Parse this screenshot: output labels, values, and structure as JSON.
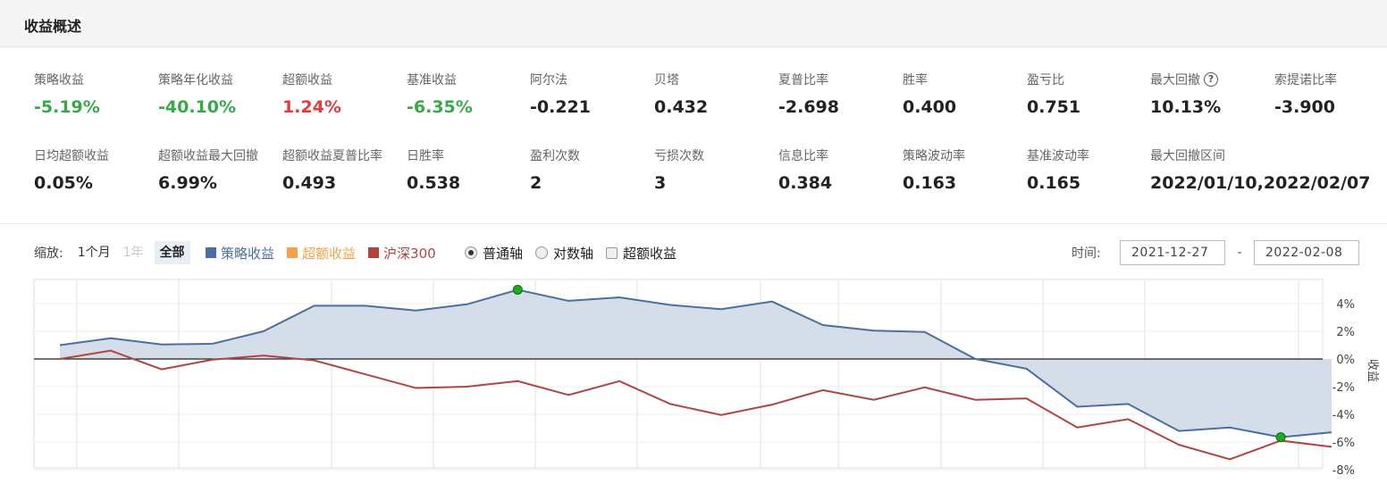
{
  "header": {
    "title": "收益概述"
  },
  "metrics_row1": [
    {
      "label": "策略收益",
      "value": "-5.19%",
      "color": "green"
    },
    {
      "label": "策略年化收益",
      "value": "-40.10%",
      "color": "green"
    },
    {
      "label": "超额收益",
      "value": "1.24%",
      "color": "red"
    },
    {
      "label": "基准收益",
      "value": "-6.35%",
      "color": "green"
    },
    {
      "label": "阿尔法",
      "value": "-0.221",
      "color": ""
    },
    {
      "label": "贝塔",
      "value": "0.432",
      "color": ""
    },
    {
      "label": "夏普比率",
      "value": "-2.698",
      "color": ""
    },
    {
      "label": "胜率",
      "value": "0.400",
      "color": ""
    },
    {
      "label": "盈亏比",
      "value": "0.751",
      "color": ""
    },
    {
      "label": "最大回撤",
      "value": "10.13%",
      "color": "",
      "help": "?"
    },
    {
      "label": "索提诺比率",
      "value": "-3.900",
      "color": ""
    }
  ],
  "metrics_row2": [
    {
      "label": "日均超额收益",
      "value": "0.05%"
    },
    {
      "label": "超额收益最大回撤",
      "value": "6.99%"
    },
    {
      "label": "超额收益夏普比率",
      "value": "0.493"
    },
    {
      "label": "日胜率",
      "value": "0.538"
    },
    {
      "label": "盈利次数",
      "value": "2"
    },
    {
      "label": "亏损次数",
      "value": "3"
    },
    {
      "label": "信息比率",
      "value": "0.384"
    },
    {
      "label": "策略波动率",
      "value": "0.163"
    },
    {
      "label": "基准波动率",
      "value": "0.165"
    },
    {
      "label": "最大回撤区间",
      "value": "2022/01/10,2022/02/07"
    }
  ],
  "toolbar": {
    "zoom_label": "缩放:",
    "zoom_1m": "1个月",
    "zoom_1y": "1年",
    "zoom_all": "全部",
    "legend": [
      {
        "label": "策略收益",
        "color": "#4a6fa0"
      },
      {
        "label": "超额收益",
        "color": "#f5a04a"
      },
      {
        "label": "沪深300",
        "color": "#b04540"
      }
    ],
    "axis_normal": "普通轴",
    "axis_log": "对数轴",
    "excess_toggle": "超额收益",
    "time_label": "时间:",
    "date_start": "2021-12-27",
    "date_sep": "-",
    "date_end": "2022-02-08"
  },
  "chart_data": {
    "type": "area",
    "ylabel": "收益",
    "ylim": [
      -8,
      6
    ],
    "y_ticks": [
      "4%",
      "2%",
      "0%",
      "-2%",
      "-4%",
      "-6%",
      "-8%"
    ],
    "y_tick_values": [
      4,
      2,
      0,
      -2,
      -4,
      -6,
      -8
    ],
    "series": [
      {
        "name": "策略收益",
        "color": "#4a6fa0",
        "values": [
          1.0,
          1.5,
          1.05,
          1.1,
          2.0,
          3.85,
          3.85,
          3.5,
          3.95,
          5.0,
          4.2,
          4.45,
          3.9,
          3.6,
          4.15,
          2.45,
          2.05,
          1.95,
          0.0,
          -0.7,
          -3.45,
          -3.25,
          -5.2,
          -4.95,
          -5.65,
          -5.3
        ]
      },
      {
        "name": "沪深300",
        "color": "#b04540",
        "values": [
          0.0,
          0.6,
          -0.75,
          -0.05,
          0.25,
          -0.1,
          -1.1,
          -2.1,
          -2.0,
          -1.6,
          -2.6,
          -1.6,
          -3.25,
          -4.05,
          -3.3,
          -2.25,
          -2.95,
          -2.05,
          -2.95,
          -2.85,
          -4.95,
          -4.35,
          -6.2,
          -7.25,
          -5.9,
          -6.35
        ]
      }
    ],
    "markers": [
      {
        "series": "策略收益",
        "index": 9
      },
      {
        "series": "策略收益",
        "index": 24
      }
    ]
  }
}
